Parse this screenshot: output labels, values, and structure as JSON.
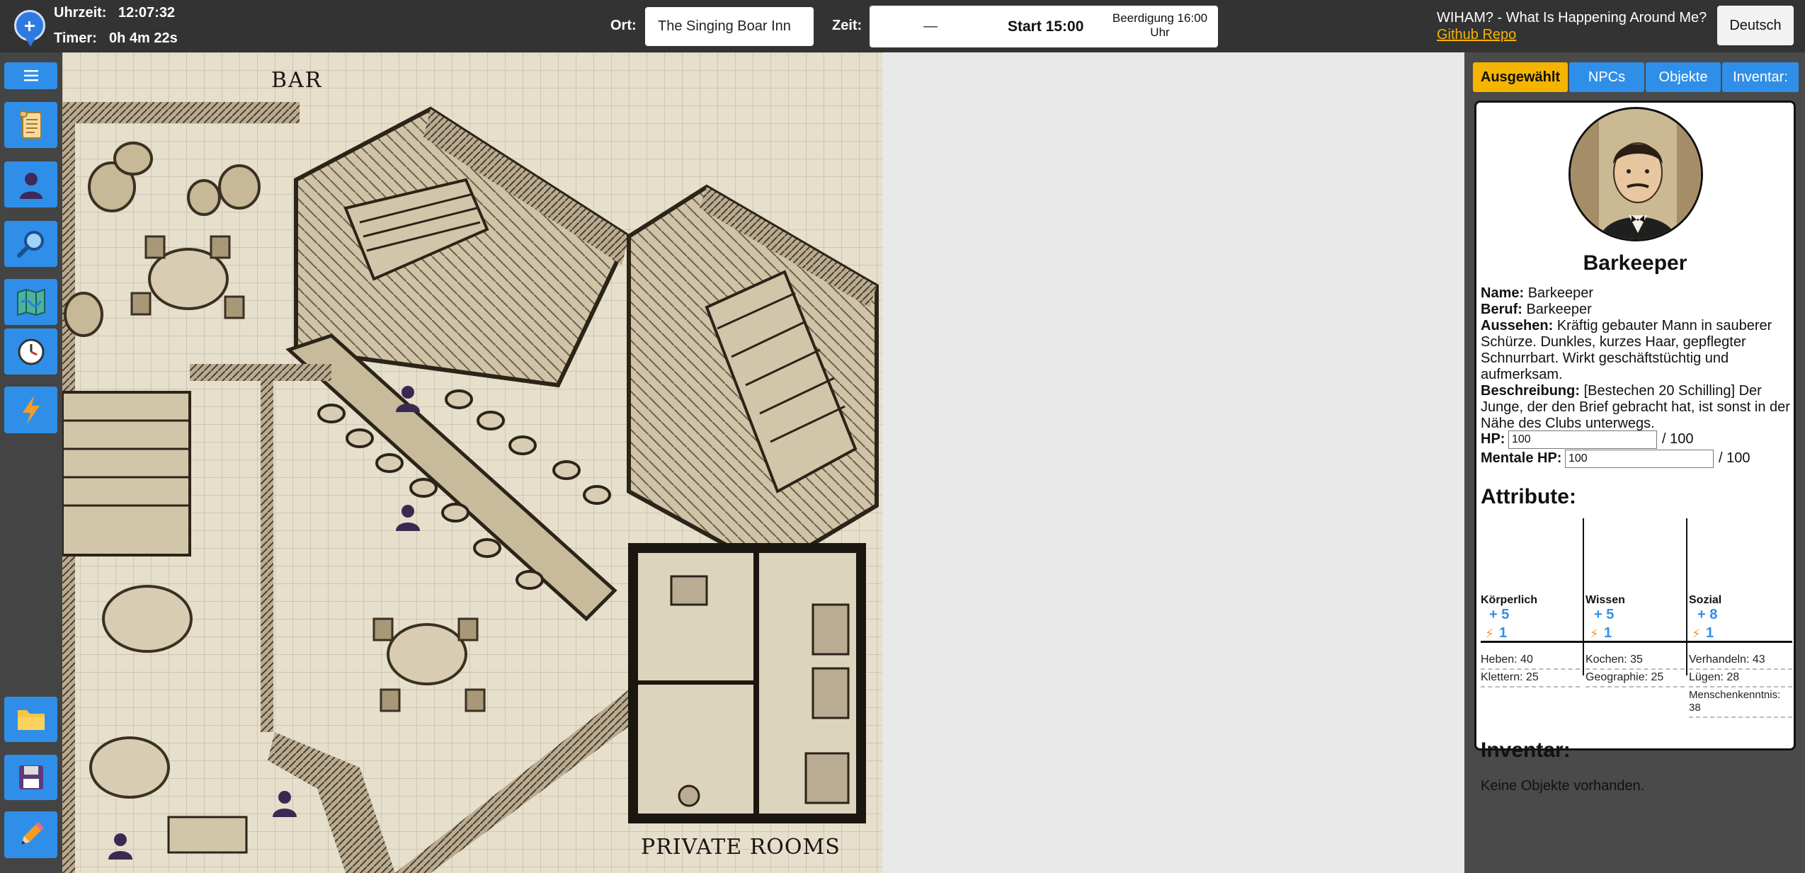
{
  "topbar": {
    "uhrzeit_label": "Uhrzeit:",
    "uhrzeit_value": "12:07:32",
    "timer_label": "Timer:",
    "timer_value": "0h 4m 22s",
    "ort_label": "Ort:",
    "ort_value": "The Singing Boar Inn",
    "zeit_label": "Zeit:",
    "zeit_dash": "—",
    "zeit_start": "Start 15:00",
    "zeit_event": "Beerdigung 16:00 Uhr",
    "wiham_title": "WIHAM? - What Is Happening Around Me?",
    "github_link": "Github Repo",
    "language_button": "Deutsch"
  },
  "sidebar": {
    "buttons": [
      {
        "icon": "menu-icon"
      },
      {
        "icon": "scroll-icon"
      },
      {
        "icon": "person-icon"
      },
      {
        "icon": "magnifier-icon"
      },
      {
        "icon": "map-icon"
      },
      {
        "icon": "clock-icon"
      },
      {
        "icon": "lightning-icon"
      },
      {
        "icon": "folder-icon"
      },
      {
        "icon": "save-icon"
      },
      {
        "icon": "pencil-icon"
      }
    ]
  },
  "map": {
    "label_bar": "BAR",
    "label_private": "PRIVATE ROOMS",
    "token_icon": "npc-token-icon"
  },
  "panel": {
    "tabs": [
      "Ausgewählt",
      "NPCs",
      "Objekte",
      "Inventar:"
    ],
    "npc": {
      "title": "Barkeeper",
      "name_label": "Name:",
      "name_value": "Barkeeper",
      "beruf_label": "Beruf:",
      "beruf_value": "Barkeeper",
      "aussehen_label": "Aussehen:",
      "aussehen_value": "Kräftig gebauter Mann in sauberer Schürze. Dunkles, kurzes Haar, gepflegter Schnurrbart. Wirkt geschäftstüchtig und aufmerksam.",
      "beschreibung_label": "Beschreibung:",
      "beschreibung_value": "[Bestechen 20 Schilling] Der Junge, der den Brief gebracht hat, ist sonst in der Nähe des Clubs unterwegs.",
      "hp_label": "HP:",
      "hp_value": "100",
      "hp_max": "/ 100",
      "mhp_label": "Mentale HP:",
      "mhp_value": "100",
      "mhp_max": "/ 100"
    },
    "attributes_title": "Attribute:",
    "attributes": [
      {
        "name": "Körperlich",
        "bonus": "+ 5",
        "points": "1",
        "skills": [
          "Heben: 40",
          "Klettern: 25"
        ]
      },
      {
        "name": "Wissen",
        "bonus": "+ 5",
        "points": "1",
        "skills": [
          "Kochen: 35",
          "Geographie: 25"
        ]
      },
      {
        "name": "Sozial",
        "bonus": "+ 8",
        "points": "1",
        "skills": [
          "Verhandeln: 43",
          "Lügen: 28",
          "Menschenkenntnis: 38"
        ]
      }
    ],
    "inventory_title": "Inventar:",
    "inventory_empty": "Keine Objekte vorhanden."
  },
  "colors": {
    "topbar": "#333333",
    "accent_blue": "#2f8fe8",
    "accent_yellow": "#f5b400",
    "sidebar": "#444444",
    "panel": "#4a4a4a"
  }
}
